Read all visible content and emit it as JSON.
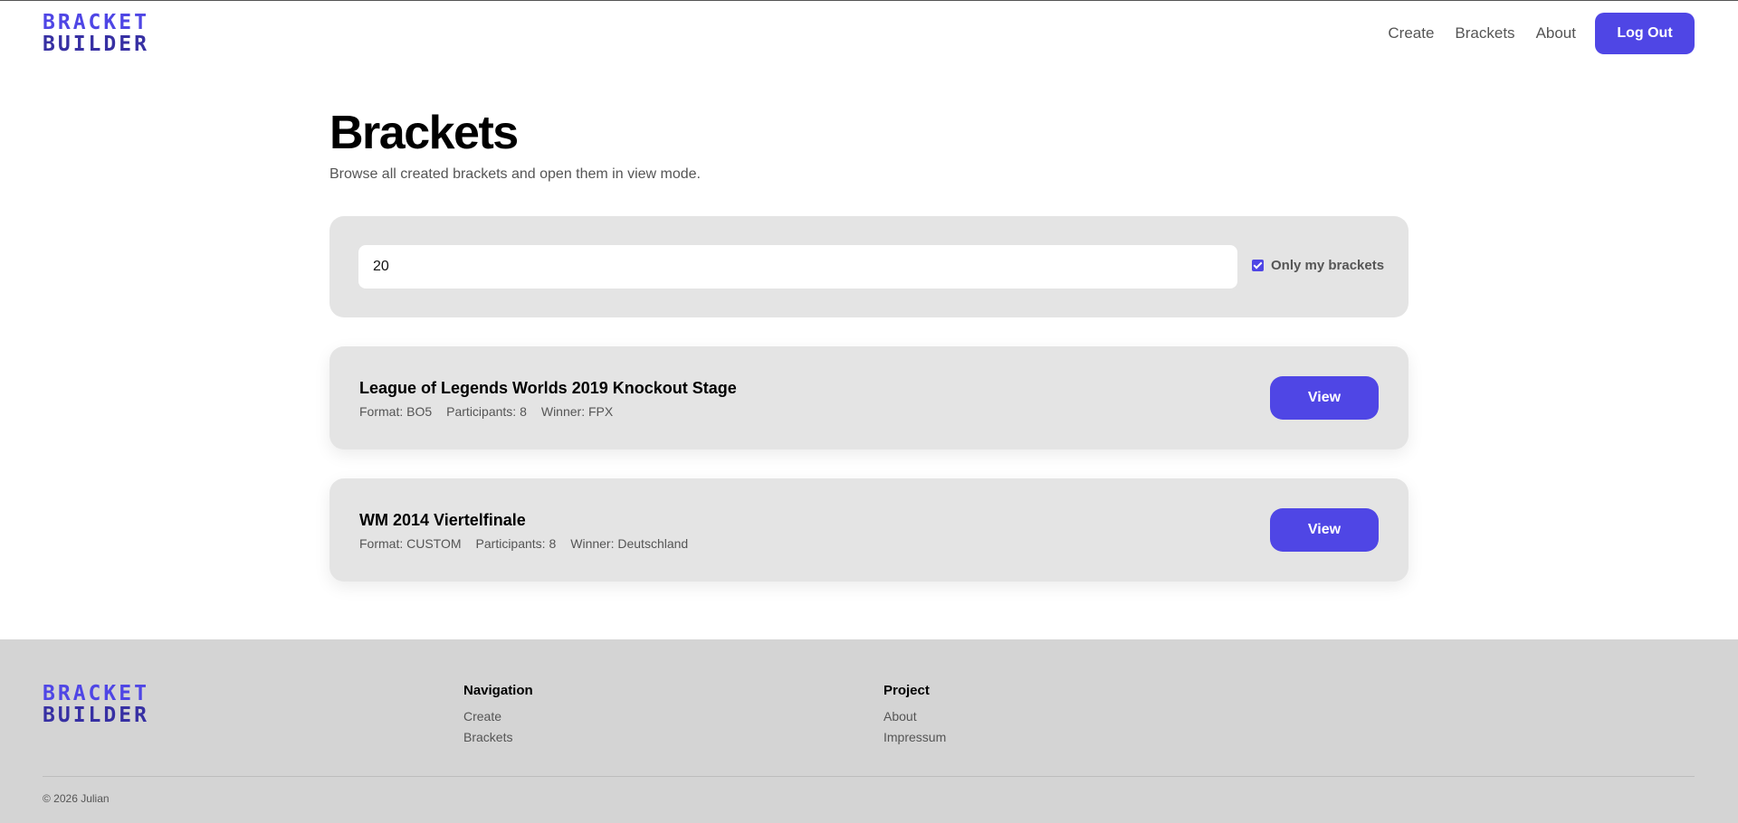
{
  "header": {
    "logo_line1": "BRACKET",
    "logo_line2": "BUILDER",
    "nav": [
      "Create",
      "Brackets",
      "About"
    ],
    "logout_label": "Log Out"
  },
  "page": {
    "title": "Brackets",
    "subtitle": "Browse all created brackets and open them in view mode."
  },
  "filter": {
    "search_value": "20",
    "only_mine_label": "Only my brackets",
    "only_mine_checked": true
  },
  "brackets": [
    {
      "title": "League of Legends Worlds 2019 Knockout Stage",
      "format": "Format: BO5",
      "participants": "Participants: 8",
      "winner": "Winner: FPX",
      "view_label": "View"
    },
    {
      "title": "WM 2014 Viertelfinale",
      "format": "Format: CUSTOM",
      "participants": "Participants: 8",
      "winner": "Winner: Deutschland",
      "view_label": "View"
    }
  ],
  "footer": {
    "logo_line1": "BRACKET",
    "logo_line2": "BUILDER",
    "navigation": {
      "heading": "Navigation",
      "links": [
        "Create",
        "Brackets"
      ]
    },
    "project": {
      "heading": "Project",
      "links": [
        "About",
        "Impressum"
      ]
    },
    "copyright": "© 2026 Julian"
  },
  "colors": {
    "accent": "#4f46e5",
    "accent_dark": "#3730a3",
    "card_bg": "#e4e4e4",
    "footer_bg": "#d4d4d4"
  }
}
